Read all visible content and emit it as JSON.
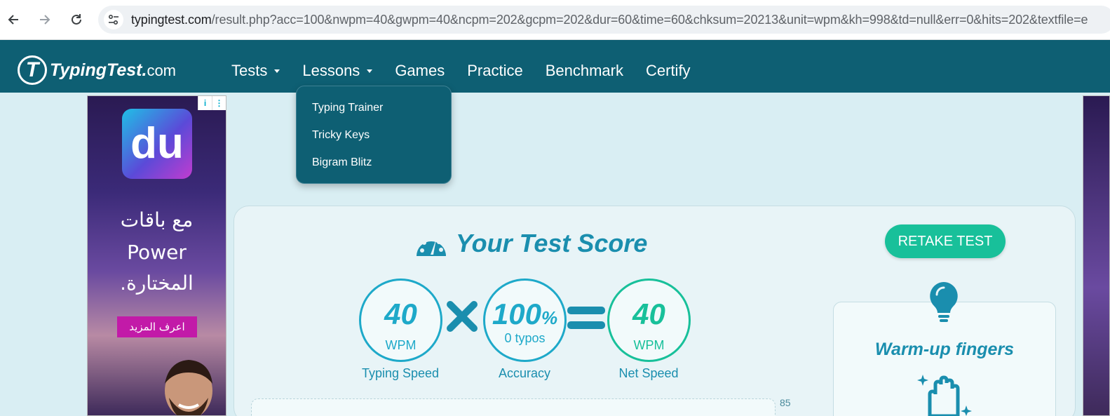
{
  "browser": {
    "url_host": "typingtest.com",
    "url_path": "/result.php?acc=100&nwpm=40&gwpm=40&ncpm=202&gcpm=202&dur=60&time=60&chksum=20213&unit=wpm&kh=998&td=null&err=0&hits=202&textfile=e"
  },
  "header": {
    "logo_main": "TypingTest.",
    "logo_suffix": "com",
    "logo_letter": "T",
    "menu": [
      {
        "label": "Tests"
      },
      {
        "label": "Lessons"
      },
      {
        "label": "Games"
      },
      {
        "label": "Practice"
      },
      {
        "label": "Benchmark"
      },
      {
        "label": "Certify"
      }
    ]
  },
  "lessons_dropdown": [
    {
      "label": "Typing Trainer"
    },
    {
      "label": "Tricky Keys"
    },
    {
      "label": "Bigram Blitz"
    }
  ],
  "ad": {
    "brand": "du",
    "line1": "مع باقات",
    "line2": "Power",
    "line3": "المختارة.",
    "cta": "اعرف المزيد",
    "info_icon": "i"
  },
  "result": {
    "title": "Your Test Score",
    "retake_label": "RETAKE TEST",
    "typing_speed": {
      "value": "40",
      "unit": "WPM",
      "label": "Typing Speed"
    },
    "accuracy": {
      "value": "100",
      "pct": "%",
      "sub": "0 typos",
      "label": "Accuracy"
    },
    "net_speed": {
      "value": "40",
      "unit": "WPM",
      "label": "Net Speed"
    },
    "chart_tick": "85"
  },
  "tip": {
    "title": "Warm-up fingers"
  },
  "colors": {
    "header_bg": "#0e5f73",
    "accent_blue": "#1ea9c9",
    "accent_green": "#18c09a",
    "page_bg": "#d9eef3"
  }
}
